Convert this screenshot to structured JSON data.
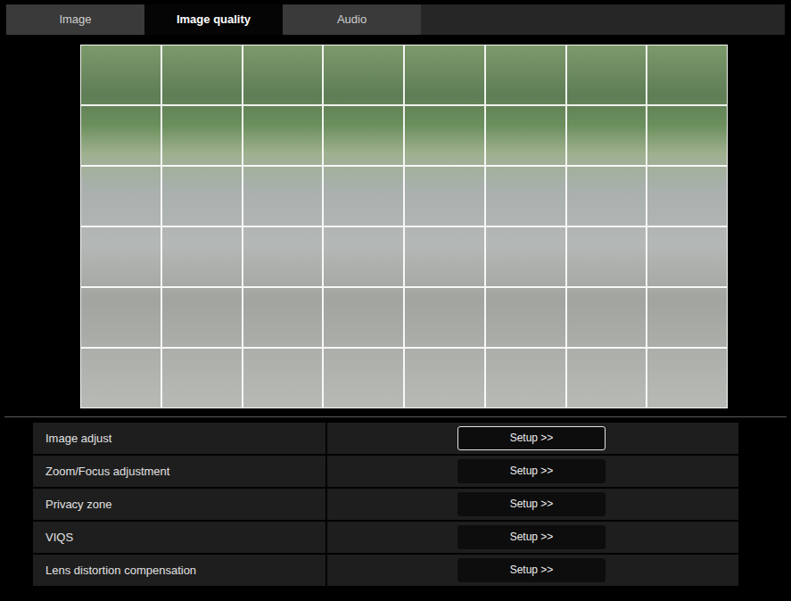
{
  "tabs": [
    {
      "label": "Image",
      "selected": false
    },
    {
      "label": "Image quality",
      "selected": true
    },
    {
      "label": "Audio",
      "selected": false
    }
  ],
  "settings": [
    {
      "label": "Image adjust",
      "button": "Setup >>",
      "focused": true
    },
    {
      "label": "Zoom/Focus adjustment",
      "button": "Setup >>",
      "focused": false
    },
    {
      "label": "Privacy zone",
      "button": "Setup >>",
      "focused": false
    },
    {
      "label": "VIQS",
      "button": "Setup >>",
      "focused": false
    },
    {
      "label": "Lens distortion compensation",
      "button": "Setup >>",
      "focused": false
    }
  ]
}
